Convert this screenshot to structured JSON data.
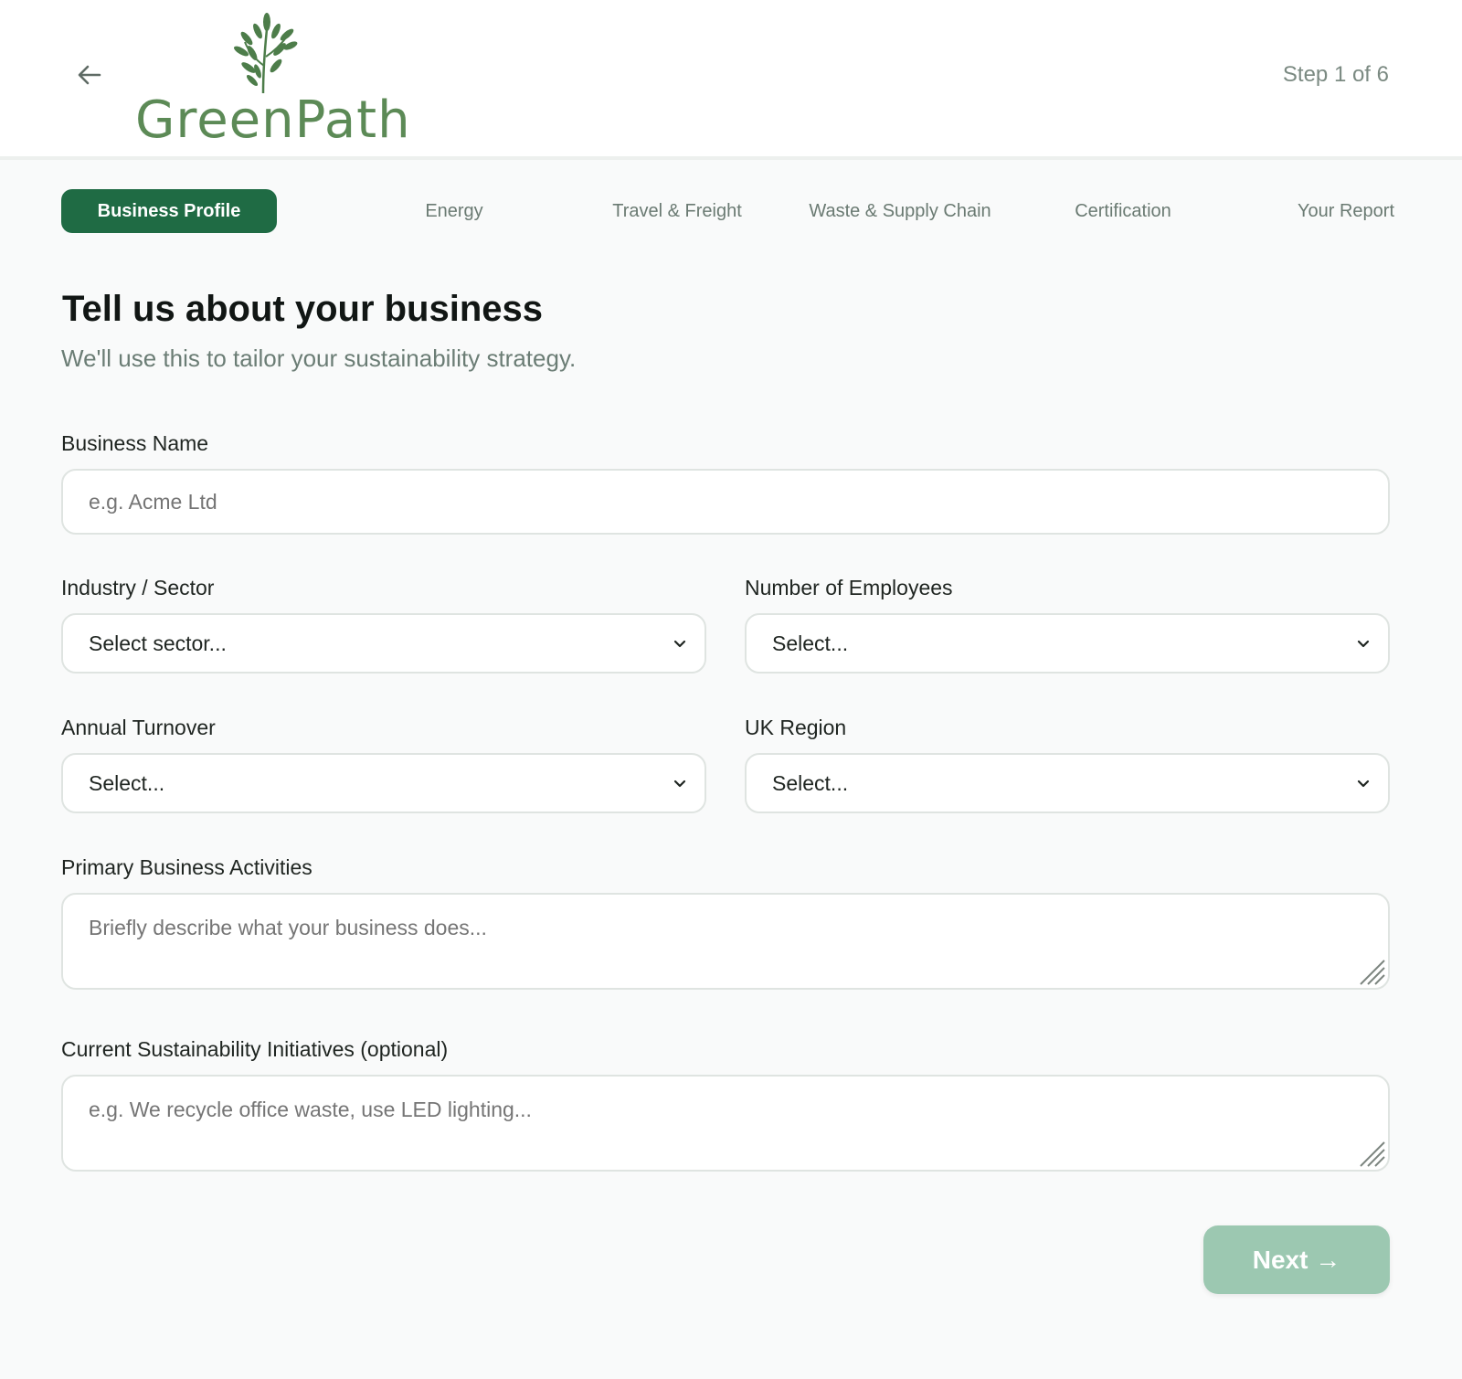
{
  "brand": {
    "name": "GreenPath",
    "color": "#5c8a56"
  },
  "header": {
    "back_icon": "arrow-left-icon",
    "step_text": "Step 1 of 6"
  },
  "tabs": [
    {
      "label": "Business Profile",
      "active": true
    },
    {
      "label": "Energy",
      "active": false
    },
    {
      "label": "Travel & Freight",
      "active": false
    },
    {
      "label": "Waste & Supply Chain",
      "active": false
    },
    {
      "label": "Certification",
      "active": false
    },
    {
      "label": "Your Report",
      "active": false
    }
  ],
  "main": {
    "title": "Tell us about your business",
    "subtitle": "We'll use this to tailor your sustainability strategy."
  },
  "form": {
    "business_name": {
      "label": "Business Name",
      "value": "",
      "placeholder": "e.g. Acme Ltd"
    },
    "industry": {
      "label": "Industry / Sector",
      "selected": "Select sector..."
    },
    "employees": {
      "label": "Number of Employees",
      "selected": "Select..."
    },
    "turnover": {
      "label": "Annual Turnover",
      "selected": "Select..."
    },
    "region": {
      "label": "UK Region",
      "selected": "Select..."
    },
    "activities": {
      "label": "Primary Business Activities",
      "value": "",
      "placeholder": "Briefly describe what your business does..."
    },
    "initiatives": {
      "label": "Current Sustainability Initiatives (optional)",
      "value": "",
      "placeholder": "e.g. We recycle office waste, use LED lighting..."
    }
  },
  "actions": {
    "next_label": "Next →"
  },
  "colors": {
    "accent": "#1f6b44",
    "next_disabled": "#9cc8b1"
  }
}
